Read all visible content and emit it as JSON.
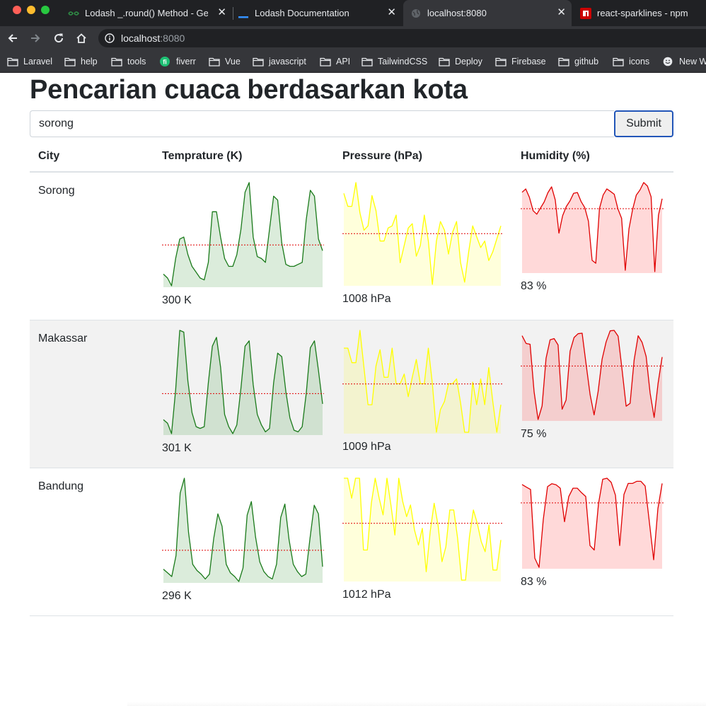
{
  "browser": {
    "tabs": [
      {
        "title": "Lodash _.round() Method - Ge",
        "favicon": "geeksforgeeks-icon",
        "active": false
      },
      {
        "title": "Lodash Documentation",
        "favicon": "lodash-icon",
        "active": false
      },
      {
        "title": "localhost:8080",
        "favicon": "globe-icon",
        "active": true
      },
      {
        "title": "react-sparklines - npm",
        "favicon": "npm-icon",
        "active": false
      }
    ],
    "url": {
      "host": "localhost",
      "port": ":8080"
    },
    "bookmarks": [
      {
        "label": "Laravel",
        "icon": "folder-icon"
      },
      {
        "label": "help",
        "icon": "folder-icon"
      },
      {
        "label": "tools",
        "icon": "folder-icon"
      },
      {
        "label": "fiverr",
        "icon": "fiverr-icon"
      },
      {
        "label": "Vue",
        "icon": "folder-icon"
      },
      {
        "label": "javascript",
        "icon": "folder-icon"
      },
      {
        "label": "API",
        "icon": "folder-icon"
      },
      {
        "label": "TailwindCSS",
        "icon": "folder-icon"
      },
      {
        "label": "Deploy",
        "icon": "folder-icon"
      },
      {
        "label": "Firebase",
        "icon": "folder-icon"
      },
      {
        "label": "github",
        "icon": "folder-icon"
      },
      {
        "label": "icons",
        "icon": "folder-icon"
      },
      {
        "label": "New W",
        "icon": "smiley-icon"
      }
    ]
  },
  "page": {
    "title": "Pencarian cuaca berdasarkan kota",
    "search": {
      "value": "sorong",
      "placeholder": ""
    },
    "submit_label": "Submit"
  },
  "table": {
    "headers": [
      "City",
      "Temprature (K)",
      "Pressure (hPa)",
      "Humidity (%)"
    ],
    "rows": [
      {
        "city": "Sorong",
        "temp_label": "300 K",
        "pressure_label": "1008 hPa",
        "humidity_label": "83 %",
        "temp": [
          299.2,
          299.0,
          298.6,
          300.0,
          301.0,
          301.1,
          300.2,
          299.6,
          299.3,
          299.0,
          298.9,
          299.8,
          302.4,
          302.4,
          301.1,
          300.0,
          299.6,
          299.6,
          300.2,
          301.5,
          303.4,
          303.9,
          301.1,
          300.1,
          300.0,
          299.8,
          301.5,
          303.2,
          303.0,
          300.8,
          299.7,
          299.6,
          299.6,
          299.7,
          299.8,
          302.0,
          303.5,
          303.2,
          301.0,
          300.4
        ],
        "pressure": [
          1009.5,
          1008.9,
          1008.9,
          1010.0,
          1008.6,
          1007.8,
          1008.0,
          1009.4,
          1008.7,
          1007.3,
          1007.3,
          1007.9,
          1008.0,
          1008.5,
          1006.3,
          1007.1,
          1007.9,
          1008.1,
          1006.6,
          1007.1,
          1008.5,
          1007.3,
          1005.3,
          1007.3,
          1008.2,
          1007.8,
          1006.7,
          1007.7,
          1008.2,
          1006.3,
          1005.4,
          1006.8,
          1008.0,
          1007.5,
          1007.0,
          1007.3,
          1006.4,
          1006.8,
          1007.4,
          1008.0
        ],
        "humidity": [
          87.6,
          89.3,
          85.0,
          78.2,
          76.4,
          79.6,
          82.7,
          87.4,
          90.4,
          83.7,
          66.7,
          75.6,
          80.3,
          83.2,
          87.1,
          87.5,
          82.9,
          79.8,
          72.8,
          52.8,
          51.3,
          79.3,
          86.2,
          89.3,
          88.0,
          86.6,
          79.1,
          74.3,
          47.7,
          68.9,
          78.9,
          86.2,
          88.8,
          92.6,
          90.8,
          85.3,
          47.0,
          75.9,
          84.3
        ]
      },
      {
        "city": "Makassar",
        "temp_label": "301 K",
        "pressure_label": "1009 hPa",
        "humidity_label": "75 %",
        "temp": [
          298.7,
          298.5,
          297.9,
          300.4,
          303.8,
          303.7,
          300.9,
          299.1,
          298.3,
          298.2,
          298.3,
          300.8,
          302.9,
          303.4,
          301.7,
          299.0,
          298.3,
          297.9,
          298.4,
          300.5,
          302.9,
          303.2,
          300.7,
          299.0,
          298.4,
          298.0,
          298.2,
          300.8,
          302.5,
          302.3,
          300.3,
          298.8,
          298.1,
          298.0,
          298.3,
          300.2,
          302.8,
          303.2,
          301.5,
          299.6
        ],
        "pressure": [
          1010.5,
          1010.5,
          1009.6,
          1009.6,
          1011.6,
          1009.3,
          1007.0,
          1007.0,
          1009.4,
          1010.4,
          1008.7,
          1008.7,
          1010.5,
          1008.3,
          1008.3,
          1008.9,
          1007.5,
          1008.7,
          1009.8,
          1008.3,
          1008.3,
          1010.5,
          1008.3,
          1005.3,
          1006.7,
          1007.2,
          1008.3,
          1008.3,
          1008.6,
          1007.1,
          1005.3,
          1005.3,
          1008.4,
          1007.0,
          1008.6,
          1007.0,
          1009.3,
          1007.2,
          1005.3,
          1007.0
        ],
        "humidity": [
          90.7,
          87.7,
          87.4,
          68.8,
          58.0,
          63.3,
          81.9,
          89.1,
          89.6,
          87.1,
          62.0,
          65.6,
          84.7,
          90.0,
          91.5,
          91.7,
          79.6,
          67.7,
          59.8,
          68.9,
          81.5,
          88.3,
          92.6,
          92.8,
          90.5,
          77.3,
          63.2,
          64.3,
          81.2,
          90.7,
          88.1,
          82.6,
          68.3,
          58.8,
          72.2,
          82.4
        ]
      },
      {
        "city": "Bandung",
        "temp_label": "296 K",
        "pressure_label": "1012 hPa",
        "humidity_label": "83 %",
        "temp": [
          293.0,
          292.7,
          292.4,
          294.1,
          299.2,
          300.4,
          296.0,
          293.4,
          292.9,
          292.6,
          292.2,
          292.6,
          295.5,
          297.5,
          296.5,
          293.4,
          292.7,
          292.4,
          292.0,
          293.1,
          297.4,
          298.5,
          295.6,
          293.6,
          292.8,
          292.4,
          292.2,
          293.4,
          297.2,
          298.3,
          295.4,
          293.4,
          292.8,
          292.4,
          292.6,
          295.5,
          298.2,
          297.5,
          293.2
        ],
        "pressure": [
          1014.2,
          1014.2,
          1013.0,
          1014.2,
          1014.2,
          1009.9,
          1009.9,
          1012.7,
          1014.2,
          1013.0,
          1012.0,
          1014.2,
          1012.6,
          1010.8,
          1014.2,
          1012.8,
          1011.9,
          1012.6,
          1011.1,
          1010.2,
          1011.2,
          1008.6,
          1011.0,
          1012.7,
          1011.4,
          1009.2,
          1010.1,
          1012.3,
          1012.3,
          1010.6,
          1008.1,
          1008.1,
          1010.7,
          1012.3,
          1011.5,
          1010.4,
          1009.8,
          1011.4,
          1008.7,
          1008.7,
          1010.5
        ],
        "humidity": [
          90.3,
          89.3,
          88.4,
          62.2,
          58.7,
          77.0,
          89.5,
          90.6,
          90.2,
          88.9,
          76.1,
          85.7,
          88.9,
          88.9,
          87.2,
          85.7,
          67.0,
          65.3,
          82.9,
          92.3,
          92.7,
          91.1,
          86.2,
          67.0,
          86.5,
          90.7,
          90.7,
          91.5,
          91.5,
          89.7,
          75.8,
          61.6,
          81.1,
          90.7
        ]
      }
    ]
  },
  "colors": {
    "temp_line": "#1a7a1a",
    "temp_fill": "rgba(34,139,34,0.16)",
    "pressure_line": "#ffff00",
    "pressure_fill": "rgba(255,255,0,0.14)",
    "humidity_line": "#e00000",
    "humidity_fill": "rgba(255,0,0,0.15)",
    "mean_line": "#e00000"
  }
}
